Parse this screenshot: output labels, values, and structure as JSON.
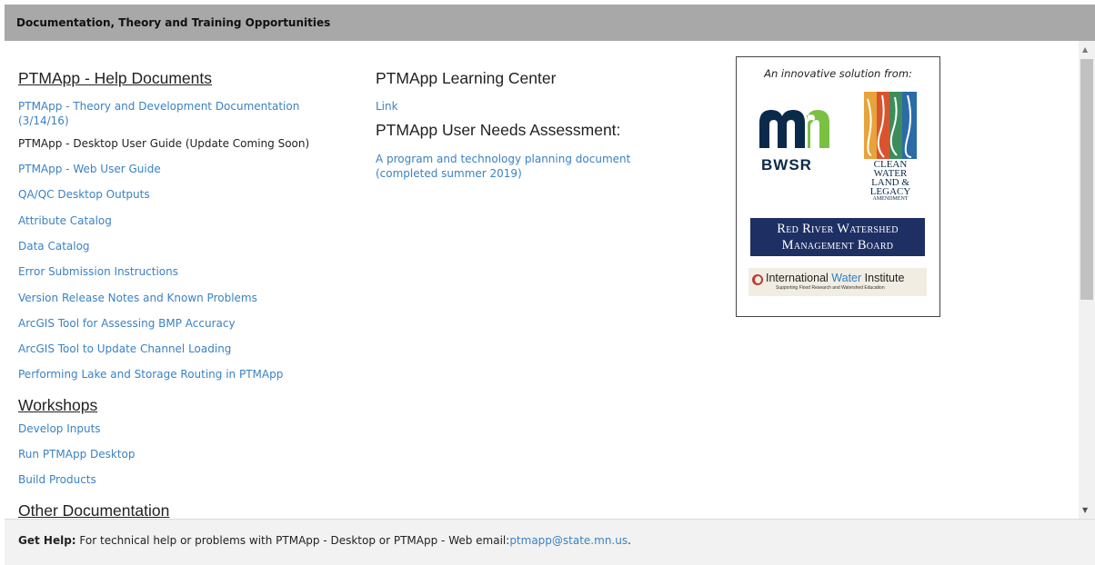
{
  "header": {
    "title": "Documentation, Theory and Training Opportunities"
  },
  "help_docs": {
    "title": "PTMApp - Help Documents",
    "items": [
      "PTMApp - Theory and Development Documentation (3/14/16)",
      "PTMApp - Desktop User Guide (Update Coming Soon)",
      "PTMApp - Web User Guide",
      "QA/QC Desktop Outputs",
      "Attribute Catalog",
      "Data Catalog",
      "Error Submission Instructions",
      "Version Release Notes and Known Problems",
      "ArcGIS Tool for Assessing BMP Accuracy",
      "ArcGIS Tool to Update Channel Loading",
      "Performing Lake and Storage Routing in PTMApp"
    ]
  },
  "workshops": {
    "title": "Workshops",
    "items": [
      "Develop Inputs",
      "Run PTMApp Desktop",
      "Build Products"
    ]
  },
  "other_docs": {
    "title": "Other Documentation"
  },
  "learning_center": {
    "title": "PTMApp Learning Center",
    "link": "Link"
  },
  "needs_assessment": {
    "title": "PTMApp User Needs Assessment:",
    "link": "A program and technology planning document (completed summer 2019)"
  },
  "partners": {
    "title": "An innovative solution from:",
    "bwsr": "BWSR",
    "clean_water": [
      "CLEAN",
      "WATER",
      "LAND &",
      "LEGACY",
      "AMENDMENT"
    ],
    "red_river": [
      "Red River Watershed",
      "Management Board"
    ],
    "iwi_prefix": "International",
    "iwi_water": "Water",
    "iwi_suffix": "Institute",
    "iwi_tagline": "Supporting Flood Research and Watershed Education"
  },
  "footer": {
    "label": "Get Help:",
    "text": "For technical help or problems with PTMApp - Desktop or PTMApp - Web email:",
    "email": "ptmapp@state.mn.us",
    "end": "."
  },
  "colors": {
    "link": "#3b82c4",
    "header_bg": "#a8a8a8",
    "red_river_bg": "#1d2f63",
    "footer_bg": "#f2f2f2"
  },
  "icons": {
    "scroll_up": "scroll-up-icon",
    "scroll_down": "scroll-down-icon"
  }
}
